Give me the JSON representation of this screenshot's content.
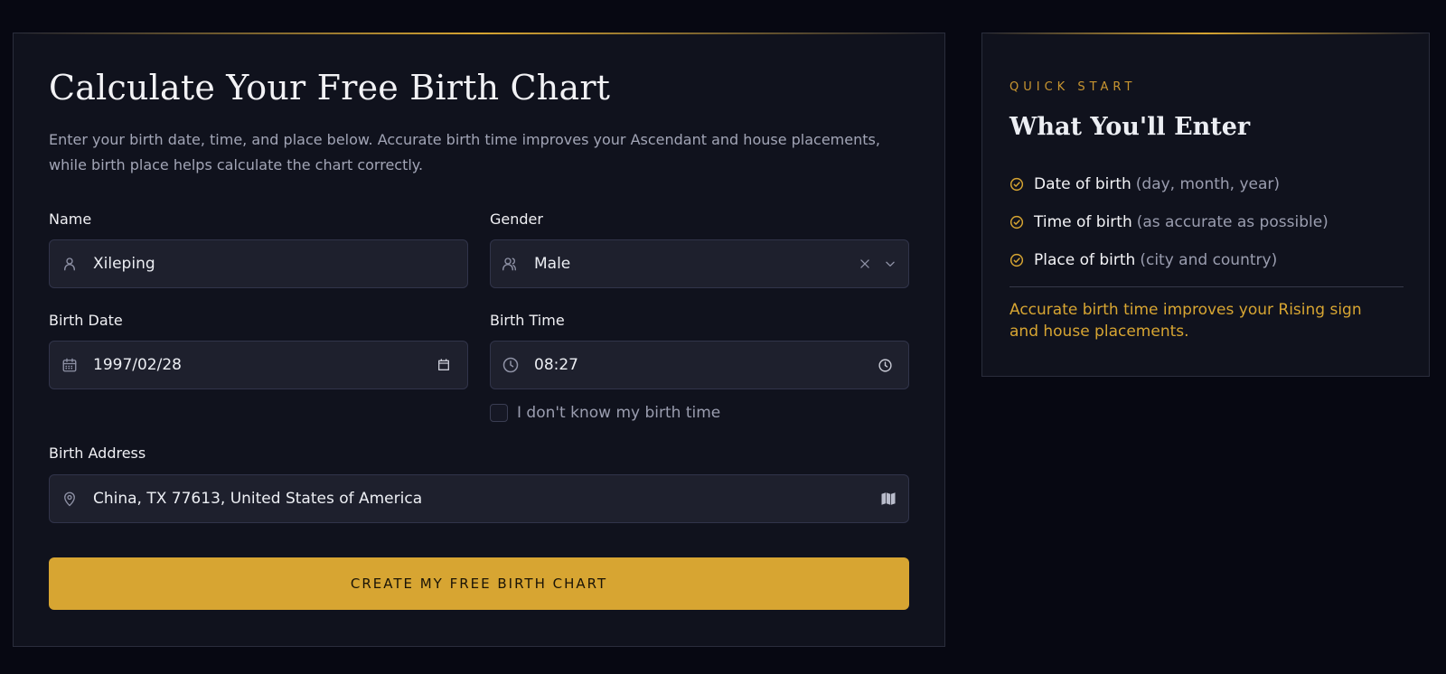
{
  "form": {
    "title": "Calculate Your Free Birth Chart",
    "intro": "Enter your birth date, time, and place below. Accurate birth time improves your Ascendant and house placements, while birth place helps calculate the chart correctly.",
    "name": {
      "label": "Name",
      "value": "Xileping",
      "icon": "user-icon"
    },
    "gender": {
      "label": "Gender",
      "value": "Male",
      "icon": "users-icon"
    },
    "birth_date": {
      "label": "Birth Date",
      "value": "1997/02/28",
      "icon": "calendar-icon"
    },
    "birth_time": {
      "label": "Birth Time",
      "value": "08:27",
      "icon": "clock-icon"
    },
    "unknown_time_label": "I don't know my birth time",
    "birth_address": {
      "label": "Birth Address",
      "value": "China, TX 77613, United States of America",
      "icon": "map-pin-icon"
    },
    "submit_label": "CREATE MY FREE BIRTH CHART"
  },
  "quick_start": {
    "eyebrow": "QUICK START",
    "title": "What You'll Enter",
    "items": [
      {
        "strong": "Date of birth",
        "muted": "(day, month, year)"
      },
      {
        "strong": "Time of birth",
        "muted": "(as accurate as possible)"
      },
      {
        "strong": "Place of birth",
        "muted": "(city and country)"
      }
    ],
    "note": "Accurate birth time improves your Rising sign and house placements."
  },
  "colors": {
    "accent": "#d7a532",
    "background": "#070812",
    "panel": "#10121d",
    "field": "#1e202d"
  }
}
